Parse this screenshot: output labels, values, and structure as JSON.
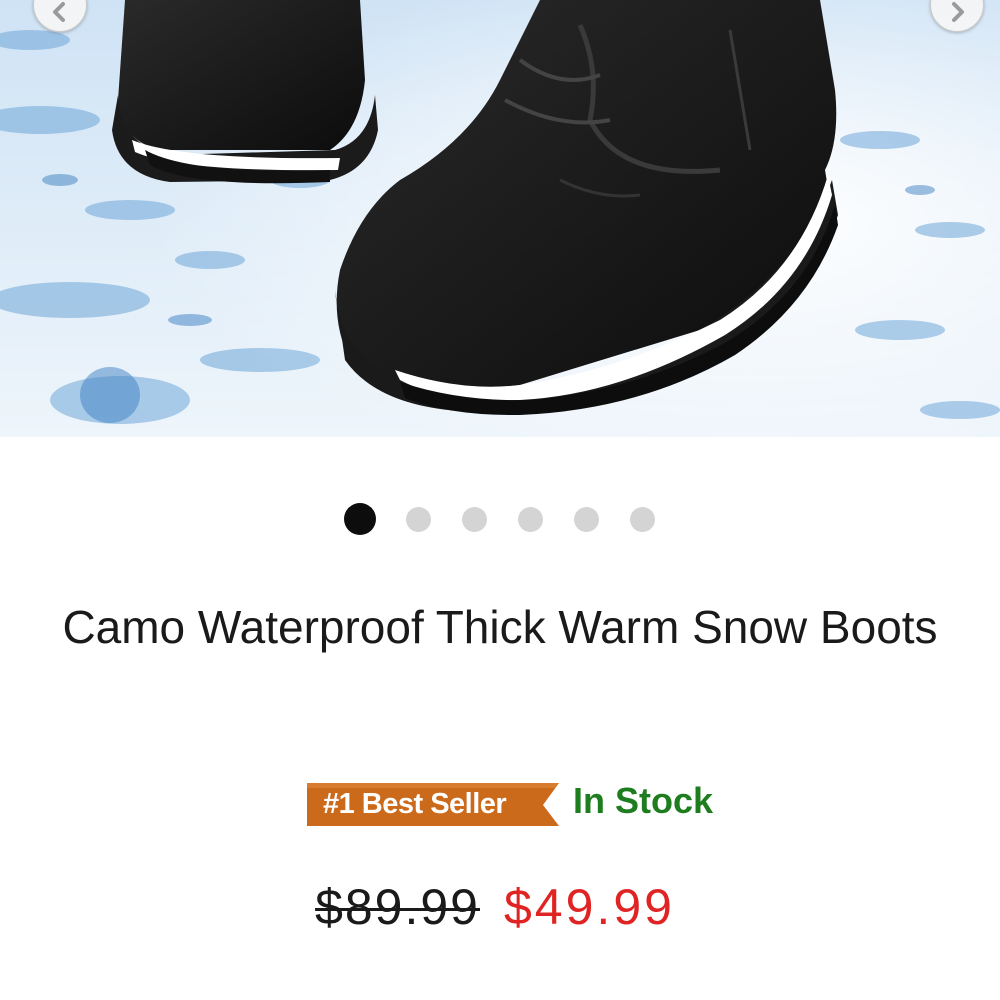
{
  "carousel": {
    "image_alt": "Black waterproof snow boots on snow",
    "prev_icon": "chevron-left-icon",
    "next_icon": "chevron-right-icon",
    "slide_count": 6,
    "active_slide": 1
  },
  "product": {
    "title": "Camo Waterproof Thick Warm Snow Boots",
    "badge_label": "#1 Best Seller",
    "stock_status": "In Stock",
    "original_price": "$89.99",
    "sale_price": "$49.99"
  },
  "colors": {
    "badge": "#cc6a1c",
    "in_stock": "#1e7d1e",
    "sale_price": "#e02424",
    "active_dot": "#0d0d0d",
    "inactive_dot": "#d4d4d4"
  }
}
